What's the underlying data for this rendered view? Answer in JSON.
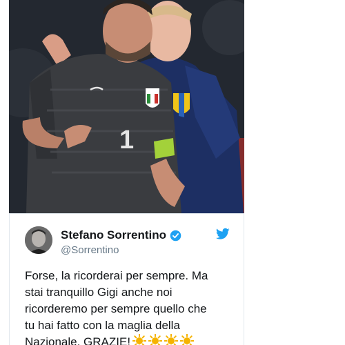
{
  "tweet": {
    "author": {
      "display_name": "Stefano Sorrentino",
      "handle": "@Sorrentino",
      "verified": true,
      "avatar_icon": "avatar-photo"
    },
    "platform_icon": "twitter-bird-icon",
    "text_lines": [
      "Forse, la ricorderai per sempre. Ma",
      "stai tranquillo Gigi anche noi",
      "ricorderemo per sempre quello che",
      "tu hai fatto con la maglia della",
      "Nazionale. GRAZIE!"
    ],
    "emoji": [
      "sun-emoji",
      "sun-emoji",
      "sun-emoji",
      "sun-emoji"
    ]
  },
  "photo": {
    "jersey_number": "1"
  },
  "colors": {
    "twitter_blue": "#1da1f2",
    "text": "#14171a",
    "muted": "#657786",
    "border": "#e1e8ed",
    "emoji_sun": "#f5b300"
  }
}
